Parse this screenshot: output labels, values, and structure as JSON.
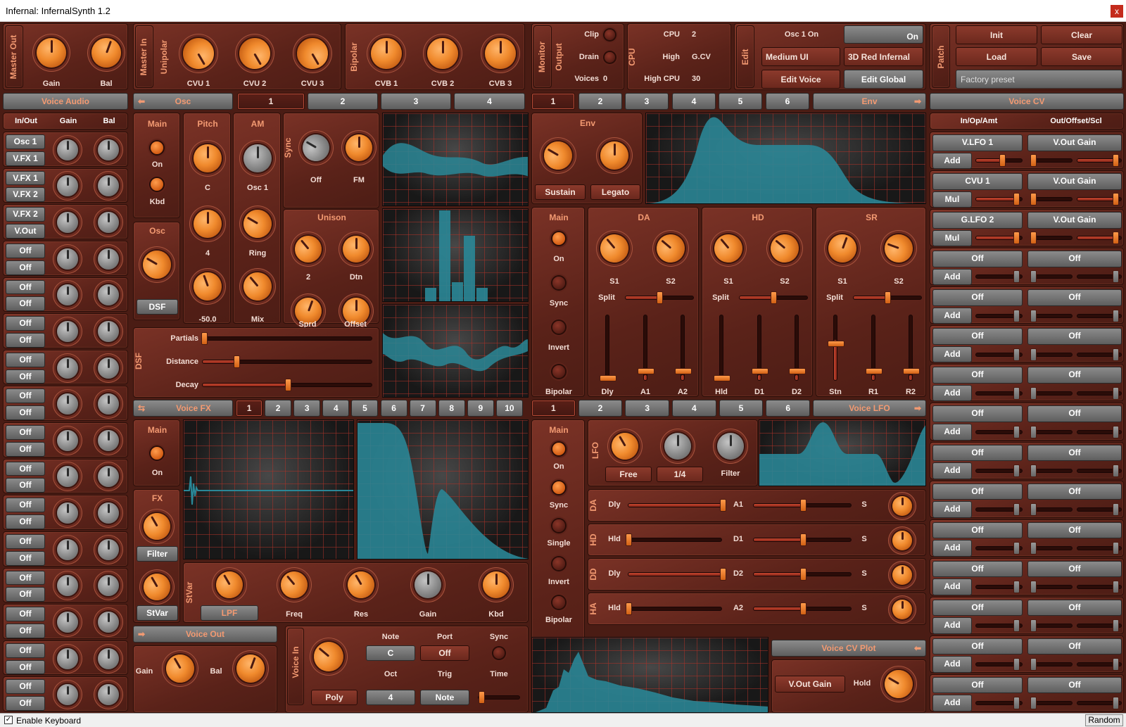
{
  "window": {
    "title": "Infernal: InfernalSynth 1.2",
    "close_glyph": "x"
  },
  "bottom": {
    "enable_keyboard": "Enable Keyboard",
    "random": "Random",
    "checkmark": "✓"
  },
  "colors": {
    "accent": "#f39a72",
    "panel": "#6a2a1f",
    "knob": "#f08a2d",
    "plot": "#2a8797"
  },
  "master_out": {
    "title": "Master Out",
    "gain": "Gain",
    "bal": "Bal"
  },
  "master_in": {
    "title": "Master In",
    "unipolar": "Unipolar",
    "cvu1": "CVU 1",
    "cvu2": "CVU 2",
    "cvu3": "CVU 3",
    "bipolar": "Bipolar",
    "cvb1": "CVB 1",
    "cvb2": "CVB 2",
    "cvb3": "CVB 3"
  },
  "monitor": {
    "title": "Monitor",
    "output": "Output",
    "clip": "Clip",
    "drain": "Drain",
    "voices_label": "Voices",
    "voices_value": "0",
    "cpu_title": "CPU",
    "cpu_label": "CPU",
    "cpu_value": "2",
    "high_label": "High",
    "high_value": "G.CV",
    "highcpu_label": "High CPU",
    "highcpu_value": "30"
  },
  "edit": {
    "title": "Edit",
    "osc1on": "Osc 1 On",
    "on": "On",
    "ui_size": "Medium UI",
    "theme": "3D Red Infernal",
    "edit_voice": "Edit Voice",
    "edit_global": "Edit Global"
  },
  "patch": {
    "title": "Patch",
    "init": "Init",
    "clear": "Clear",
    "load": "Load",
    "save": "Save",
    "preset": "Factory preset"
  },
  "voice_audio": {
    "title": "Voice Audio",
    "cols": [
      "In/Out",
      "Gain",
      "Bal"
    ],
    "routes": [
      "Osc 1",
      "V.FX 1",
      "V.FX 1",
      "V.FX 2",
      "V.FX 2",
      "V.Out",
      "Off",
      "Off",
      "Off",
      "Off",
      "Off",
      "Off",
      "Off",
      "Off",
      "Off",
      "Off",
      "Off",
      "Off",
      "Off",
      "Off",
      "Off",
      "Off",
      "Off",
      "Off",
      "Off",
      "Off",
      "Off",
      "Off",
      "Off",
      "Off",
      "Off",
      "Off"
    ]
  },
  "osc": {
    "title": "Osc",
    "tabs": [
      "1",
      "2",
      "3",
      "4"
    ],
    "main": "Main",
    "on": "On",
    "kbd": "Kbd",
    "osc_label": "Osc",
    "dsf_button": "DSF",
    "pitch": "Pitch",
    "pitch_c": "C",
    "pitch_4": "4",
    "pitch_val": "-50.0",
    "am": "AM",
    "osc1": "Osc 1",
    "ring": "Ring",
    "mix": "Mix",
    "sync": "Sync",
    "off": "Off",
    "fm": "FM",
    "unison": "Unison",
    "uni_2": "2",
    "dtn": "Dtn",
    "sprd": "Sprd",
    "offset": "Offset",
    "dsf_title": "DSF",
    "partials": "Partials",
    "partials_level": 0.01,
    "distance": "Distance",
    "distance_level": 0.2,
    "decay": "Decay",
    "decay_level": 0.5
  },
  "env": {
    "tabs": [
      "1",
      "2",
      "3",
      "4",
      "5",
      "6"
    ],
    "title": "Env",
    "env": "Env",
    "sustain": "Sustain",
    "legato": "Legato",
    "main": "Main",
    "on": "On",
    "sync": "Sync",
    "invert": "Invert",
    "bipolar": "Bipolar",
    "da": "DA",
    "hd": "HD",
    "sr": "SR",
    "s1": "S1",
    "s2": "S2",
    "split": "Split",
    "dly": "Dly",
    "a1": "A1",
    "a2": "A2",
    "hld": "Hld",
    "d1": "D1",
    "d2": "D2",
    "stn": "Stn",
    "r1": "R1",
    "r2": "R2"
  },
  "voice_fx": {
    "title": "Voice FX",
    "tabs": [
      "1",
      "2",
      "3",
      "4",
      "5",
      "6",
      "7",
      "8",
      "9",
      "10"
    ],
    "main": "Main",
    "on": "On",
    "fx": "FX",
    "filter": "Filter",
    "stvar_btn": "StVar",
    "stvar": "StVar",
    "lpf": "LPF",
    "freq": "Freq",
    "res": "Res",
    "gain": "Gain",
    "kbd": "Kbd"
  },
  "voice_lfo": {
    "title": "Voice LFO",
    "tabs": [
      "1",
      "2",
      "3",
      "4",
      "5",
      "6"
    ],
    "main": "Main",
    "on": "On",
    "sync": "Sync",
    "single": "Single",
    "invert": "Invert",
    "bipolar": "Bipolar",
    "lfo": "LFO",
    "free": "Free",
    "rate": "1/4",
    "filter": "Filter",
    "rows": [
      {
        "label": "DA",
        "a": "Dly",
        "b": "A1",
        "s": "S"
      },
      {
        "label": "HD",
        "a": "Hld",
        "b": "D1",
        "s": "S"
      },
      {
        "label": "DD",
        "a": "Dly",
        "b": "D2",
        "s": "S"
      },
      {
        "label": "HA",
        "a": "Hld",
        "b": "A2",
        "s": "S"
      }
    ]
  },
  "voice_out": {
    "title": "Voice Out",
    "gain": "Gain",
    "bal": "Bal"
  },
  "voice_in": {
    "title": "Voice In",
    "note": "Note",
    "port": "Port",
    "sync": "Sync",
    "note_val": "C",
    "port_val": "Off",
    "oct": "Oct",
    "trig": "Trig",
    "time": "Time",
    "poly": "Poly",
    "oct_val": "4",
    "trig_val": "Note"
  },
  "voice_cv_plot": {
    "title": "Voice CV Plot",
    "target": "V.Out Gain",
    "hold": "Hold"
  },
  "voice_cv": {
    "title": "Voice CV",
    "col1": "In/Op/Amt",
    "col2": "Out/Offset/Scl",
    "rows": [
      {
        "src": "V.LFO 1",
        "op": "Add",
        "dst": "V.Out Gain"
      },
      {
        "src": "CVU 1",
        "op": "Mul",
        "dst": "V.Out Gain"
      },
      {
        "src": "G.LFO 2",
        "op": "Mul",
        "dst": "V.Out Gain"
      },
      {
        "src": "Off",
        "op": "Add",
        "dst": "Off"
      },
      {
        "src": "Off",
        "op": "Add",
        "dst": "Off"
      },
      {
        "src": "Off",
        "op": "Add",
        "dst": "Off"
      },
      {
        "src": "Off",
        "op": "Add",
        "dst": "Off"
      },
      {
        "src": "Off",
        "op": "Add",
        "dst": "Off"
      },
      {
        "src": "Off",
        "op": "Add",
        "dst": "Off"
      },
      {
        "src": "Off",
        "op": "Add",
        "dst": "Off"
      },
      {
        "src": "Off",
        "op": "Add",
        "dst": "Off"
      },
      {
        "src": "Off",
        "op": "Add",
        "dst": "Off"
      },
      {
        "src": "Off",
        "op": "Add",
        "dst": "Off"
      },
      {
        "src": "Off",
        "op": "Add",
        "dst": "Off"
      },
      {
        "src": "Off",
        "op": "Add",
        "dst": "Off"
      }
    ]
  }
}
